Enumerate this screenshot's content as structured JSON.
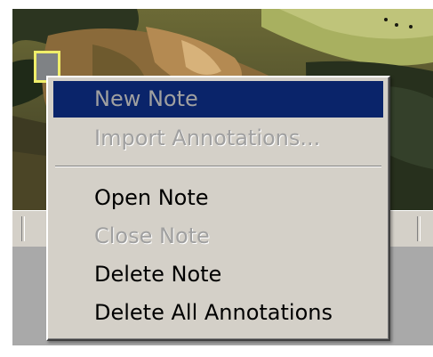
{
  "context_menu": {
    "items": [
      {
        "label": "New Note",
        "state": "highlighted-disabled"
      },
      {
        "label": "Import Annotations...",
        "state": "disabled"
      },
      {
        "label": "Open Note",
        "state": "enabled"
      },
      {
        "label": "Close Note",
        "state": "disabled"
      },
      {
        "label": "Delete Note",
        "state": "enabled"
      },
      {
        "label": "Delete All Annotations",
        "state": "enabled"
      }
    ]
  },
  "colors": {
    "menu_background": "#d4d0c8",
    "highlight": "#0a246a",
    "disabled_text": "#a0a0a0",
    "note_marker_border": "#f0ee6a",
    "workspace": "#a9a9a9"
  },
  "icons": {
    "note_marker": "note-marker-icon"
  }
}
